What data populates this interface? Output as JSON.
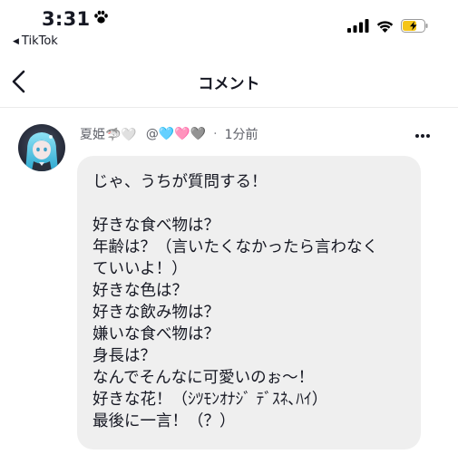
{
  "status_bar": {
    "time": "3:31",
    "back_app": "TikTok"
  },
  "header": {
    "title": "コメント"
  },
  "comment": {
    "username": "夏姫🦈🤍",
    "mention": "@🩵🩷🩶",
    "separator": "·",
    "timestamp": "1分前",
    "lines": [
      "じゃ、うちが質問する！",
      "",
      "好きな食べ物は？",
      "年齢は？（言いたくなかったら言わなく",
      "ていいよ！）",
      "好きな色は？",
      "好きな飲み物は？",
      "嫌いな食べ物は？",
      "身長は？",
      "なんでそんなに可愛いのぉ〜！",
      "好きな花！（ｼﾂﾓﾝｵﾅｼﾞ ﾃﾞｽﾈ､ﾊｲ）",
      "最後に一言！（？）"
    ]
  },
  "icons": {
    "paw": "paw-icon",
    "back": "chevron-left-icon",
    "more": "more-options-icon",
    "signal": "signal-icon",
    "wifi": "wifi-icon",
    "battery": "battery-charging-icon"
  },
  "colors": {
    "bubble_bg": "#efefef",
    "battery_fill": "#f5c518",
    "text_secondary": "#5e6068"
  }
}
